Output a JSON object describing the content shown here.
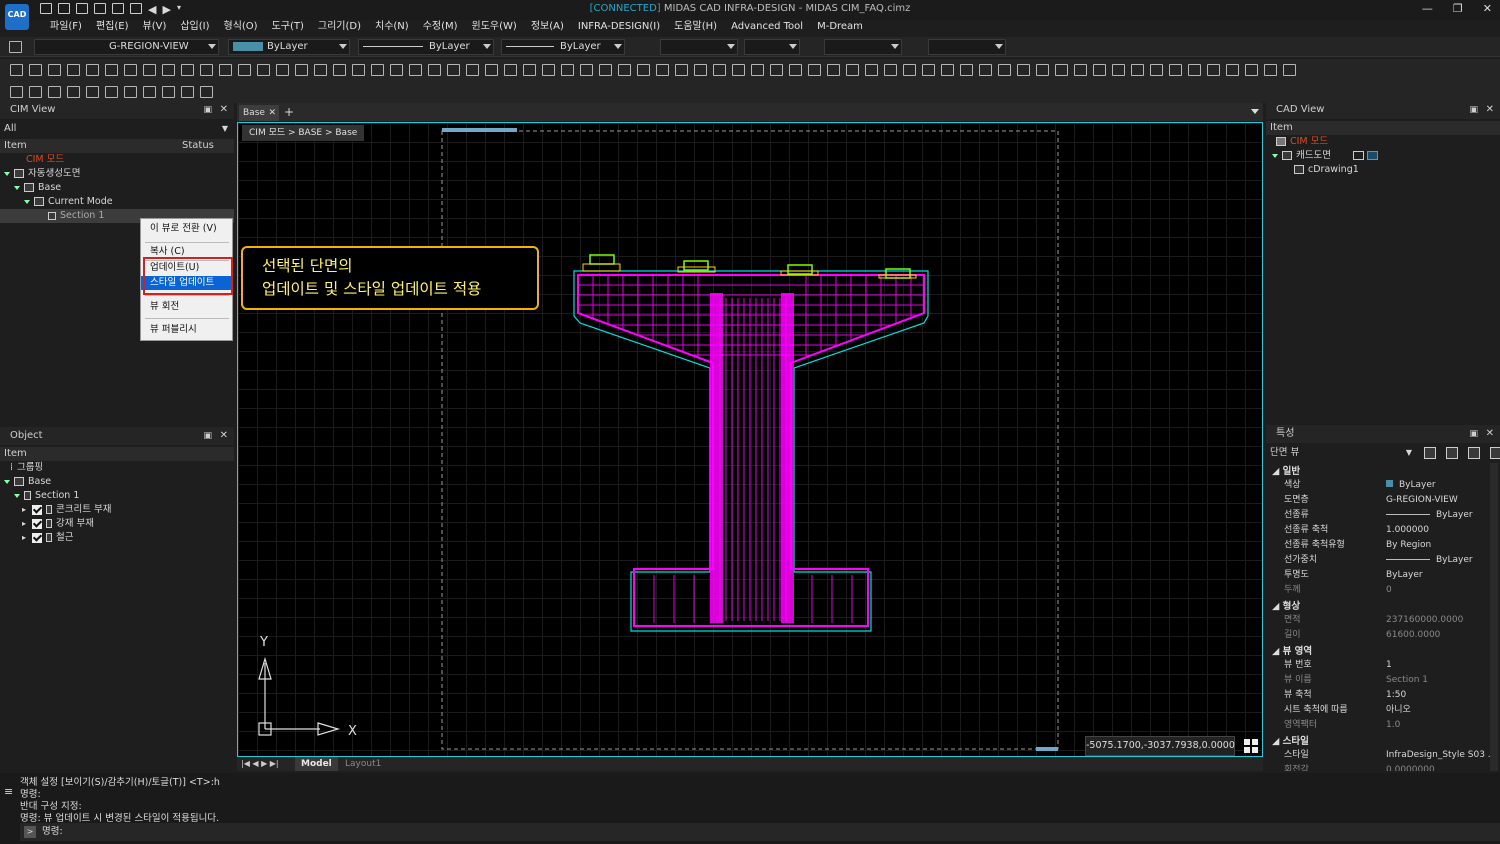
{
  "app": {
    "logo": "CAD",
    "title_prefix": "[CONNECTED]",
    "title_rest": " MIDAS CAD INFRA-DESIGN - MIDAS CIM_FAQ.cimz"
  },
  "menu": [
    "파일(F)",
    "편집(E)",
    "뷰(V)",
    "삽입(I)",
    "형식(O)",
    "도구(T)",
    "그리기(D)",
    "치수(N)",
    "수정(M)",
    "윈도우(W)",
    "정보(A)",
    "INFRA-DESIGN(I)",
    "도움말(H)",
    "Advanced Tool",
    "M-Dream"
  ],
  "props": {
    "layer": "G-REGION-VIEW",
    "color": "ByLayer",
    "linetype": "ByLayer",
    "lineweight": "ByLayer"
  },
  "cim_view": {
    "title": "CIM View",
    "filter": "All",
    "col_item": "Item",
    "col_status": "Status",
    "tree": [
      "CIM 모드",
      "자동생성도면",
      "Base",
      "Current Mode",
      "Section 1"
    ]
  },
  "context_menu": [
    "이 뷰로 전환 (V)",
    "복사 (C)",
    "업데이트(U)",
    "스타일 업데이트",
    "뷰 회전",
    "뷰 퍼블리시"
  ],
  "object": {
    "title": "Object",
    "col_item": "Item",
    "tree": [
      "그룹핑",
      "Base",
      "Section 1",
      "콘크리트 부재",
      "강재 부재",
      "철근"
    ]
  },
  "doc": {
    "tab": "Base",
    "breadcrumb": "CIM 모드 > BASE > Base"
  },
  "callout": [
    "선택된 단면의",
    "업데이트 및 스타일 업데이트 적용"
  ],
  "coords": "-5075.1700,-3037.7938,0.0000",
  "layout_tabs": [
    "Model",
    "Layout1"
  ],
  "cad_view": {
    "title": "CAD View",
    "col_item": "Item",
    "tree": [
      "CIM 모드",
      "캐드도면",
      "cDrawing1"
    ]
  },
  "properties": {
    "title": "특성",
    "selector": "단면 뷰",
    "cat_general": "일반",
    "cat_shape": "형상",
    "cat_view": "뷰 영역",
    "cat_style": "스타일",
    "rows": [
      {
        "k": "색상",
        "v": "ByLayer"
      },
      {
        "k": "도면층",
        "v": "G-REGION-VIEW"
      },
      {
        "k": "선종류",
        "v": "ByLayer"
      },
      {
        "k": "선종류 축척",
        "v": "1.000000"
      },
      {
        "k": "선종류 축척유형",
        "v": "By Region"
      },
      {
        "k": "선가중치",
        "v": "ByLayer"
      },
      {
        "k": "투명도",
        "v": "ByLayer"
      },
      {
        "k": "두께",
        "v": "0"
      },
      {
        "k": "면적",
        "v": "237160000.0000"
      },
      {
        "k": "길이",
        "v": "61600.0000"
      },
      {
        "k": "뷰 번호",
        "v": "1"
      },
      {
        "k": "뷰 이름",
        "v": "Section 1"
      },
      {
        "k": "뷰 축척",
        "v": "1:50"
      },
      {
        "k": "시트 축척에 따름",
        "v": "아니오"
      },
      {
        "k": "영역팩터",
        "v": "1.0"
      },
      {
        "k": "스타일",
        "v": "InfraDesign_Style S03 ..."
      },
      {
        "k": "회전각",
        "v": "0.0000000"
      }
    ]
  },
  "command": {
    "lines": [
      "객체 설정 [보이기(S)/감추기(H)/토글(T)] <T>:h",
      "명령:",
      "반대 구성 지정:",
      "명령: 뷰 업데이트 시 변경된 스타일이 적용됩니다."
    ],
    "prompt": "명령:"
  },
  "axis": {
    "x": "X",
    "y": "Y"
  },
  "colors": {
    "accent": "#22c9d6",
    "section": "#ff00ff",
    "outline": "#00e0e0",
    "bearing": "#7cfc00",
    "callout_border": "#f2b400"
  }
}
